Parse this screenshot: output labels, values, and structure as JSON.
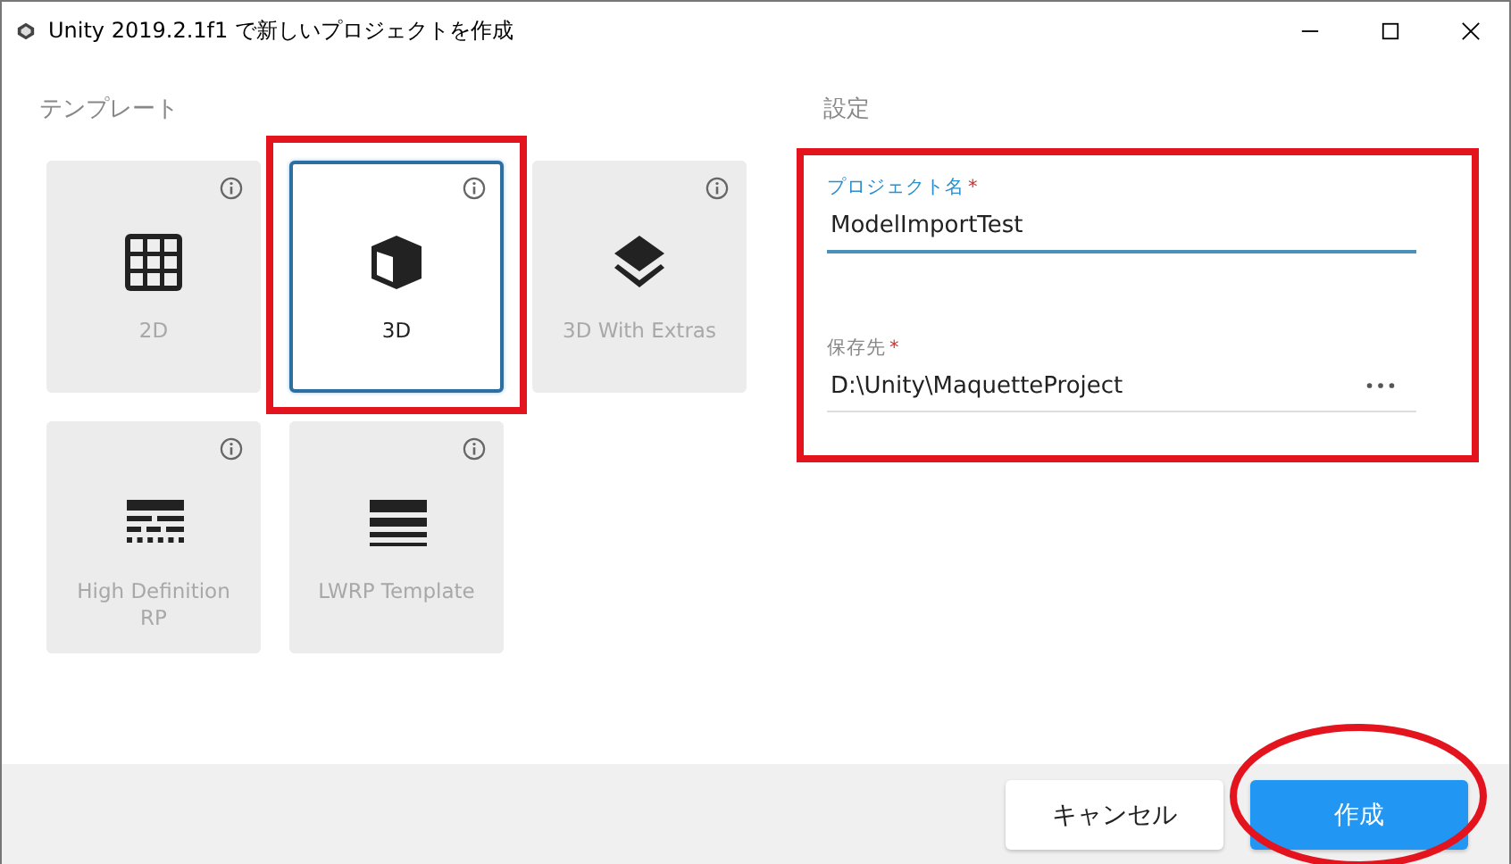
{
  "window": {
    "title": "Unity 2019.2.1f1 で新しいプロジェクトを作成"
  },
  "templates": {
    "heading": "テンプレート",
    "items": [
      {
        "label": "2D",
        "kind": "grid",
        "selected": false,
        "highlighted": false
      },
      {
        "label": "3D",
        "kind": "cube",
        "selected": true,
        "highlighted": true
      },
      {
        "label": "3D With Extras",
        "kind": "layers",
        "selected": false,
        "highlighted": false
      },
      {
        "label": "High Definition RP",
        "kind": "hdrp",
        "selected": false,
        "highlighted": false
      },
      {
        "label": "LWRP Template",
        "kind": "lwrp",
        "selected": false,
        "highlighted": false
      }
    ]
  },
  "settings": {
    "heading": "設定",
    "highlighted": true,
    "fields": [
      {
        "label": "プロジェクト名",
        "required_mark": "*",
        "value": "ModelImportTest",
        "focused": true,
        "browse": false
      },
      {
        "label": "保存先",
        "required_mark": "*",
        "value": "D:\\Unity\\MaquetteProject",
        "focused": false,
        "browse": true
      }
    ]
  },
  "buttons": [
    {
      "label": "キャンセル",
      "kind": "secondary",
      "circled": false
    },
    {
      "label": "作成",
      "kind": "primary",
      "circled": true
    }
  ]
}
